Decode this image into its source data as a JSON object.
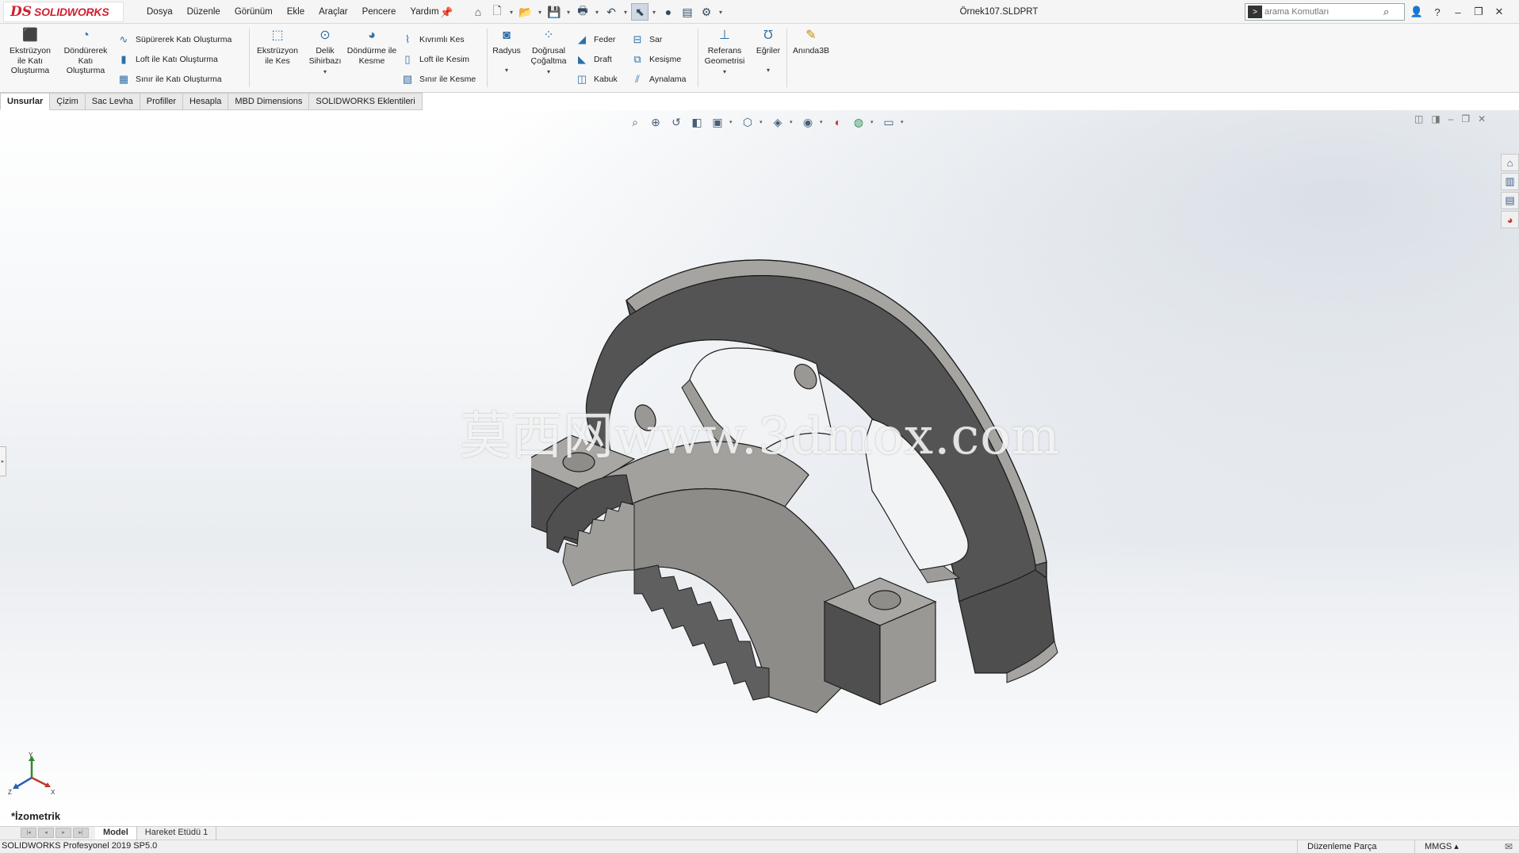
{
  "app": {
    "brand_ds": "DS",
    "brand_name": "SOLIDWORKS",
    "document_title": "Örnek107.SLDPRT"
  },
  "menu": [
    "Dosya",
    "Düzenle",
    "Görünüm",
    "Ekle",
    "Araçlar",
    "Pencere",
    "Yardım"
  ],
  "search": {
    "placeholder": "arama Komutları"
  },
  "command_manager": {
    "extrude_boss": "Ekstrüzyon ile Katı Oluşturma",
    "revolve_boss": "Döndürerek Katı Oluşturma",
    "sweep_boss": "Süpürerek Katı Oluşturma",
    "loft_boss": "Loft ile Katı Oluşturma",
    "boundary_boss": "Sınır ile Katı Oluşturma",
    "extrude_cut": "Ekstrüzyon ile Kes",
    "hole_wizard": "Delik Sihirbazı",
    "revolve_cut": "Döndürme ile Kesme",
    "swept_cut": "Kıvrımlı Kes",
    "lofted_cut": "Loft ile Kesim",
    "boundary_cut": "Sınır ile Kesme",
    "fillet": "Radyus",
    "linear_pattern": "Doğrusal Çoğaltma",
    "rib": "Feder",
    "draft": "Draft",
    "shell": "Kabuk",
    "wrap": "Sar",
    "intersect": "Kesişme",
    "mirror": "Aynalama",
    "reference_geometry": "Referans Geometrisi",
    "curves": "Eğriler",
    "instant3d": "Anında3B"
  },
  "tabs": [
    {
      "label": "Unsurlar",
      "active": true
    },
    {
      "label": "Çizim",
      "active": false
    },
    {
      "label": "Sac Levha",
      "active": false
    },
    {
      "label": "Profiller",
      "active": false
    },
    {
      "label": "Hesapla",
      "active": false
    },
    {
      "label": "MBD Dimensions",
      "active": false
    },
    {
      "label": "SOLIDWORKS Eklentileri",
      "active": false
    }
  ],
  "viewport": {
    "watermark": "莫西网www.3dmox.com",
    "view_orientation": "*İzometrik",
    "triad_axes": {
      "x": "X",
      "y": "Y",
      "z": "Z"
    }
  },
  "bottom_tabs": [
    {
      "label": "Model",
      "active": true
    },
    {
      "label": "Hareket Etüdü 1",
      "active": false
    }
  ],
  "status": {
    "version": "SOLIDWORKS Profesyonel 2019 SP5.0",
    "mode": "Düzenleme Parça",
    "units": "MMGS"
  },
  "colors": {
    "brand": "#d1202f",
    "part_face_light": "#a3a19e",
    "part_face_dark": "#545454",
    "active_tab": "#ffffff"
  },
  "icons": {
    "qat": [
      "home-icon",
      "new-document-icon",
      "open-icon",
      "save-icon",
      "print-icon",
      "undo-icon",
      "select-icon",
      "rebuild-icon",
      "file-properties-icon",
      "options-icon"
    ],
    "hud": [
      "zoom-to-fit-icon",
      "zoom-to-area-icon",
      "previous-view-icon",
      "section-view-icon",
      "dynamic-annotation-icon",
      "view-orientation-icon",
      "display-style-icon",
      "hide-show-icon",
      "edit-appearance-icon",
      "apply-scene-icon",
      "view-settings-icon"
    ],
    "taskpane": [
      "solidworks-resources-icon",
      "design-library-icon",
      "file-explorer-icon",
      "appearances-icon"
    ]
  }
}
